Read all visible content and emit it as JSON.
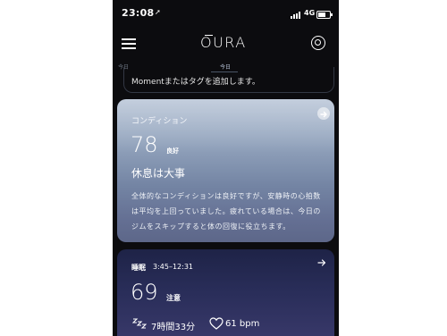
{
  "status_bar": {
    "time": "23:08",
    "location_icon": "location-arrow-icon",
    "network": "4G",
    "battery_level": 0.7
  },
  "header": {
    "menu_icon": "hamburger-menu-icon",
    "brand": "OURA",
    "settings_icon": "settings-ring-icon"
  },
  "day_tabs": {
    "prev": "今日",
    "current": "今日"
  },
  "moment_banner": {
    "text": "Momentまたはタグを追加します。"
  },
  "readiness_card": {
    "title": "コンディション",
    "score": "78",
    "rating": "良好",
    "headline": "休息は大事",
    "description": "全体的なコンディションは良好ですが、安静時の心拍数は平均を上回っていました。疲れている場合は、今日のジムをスキップすると体の回復に役立ちます。",
    "arrow_icon": "arrow-right-circle-icon"
  },
  "sleep_card": {
    "title": "睡眠",
    "time_range": "3:45–12:31",
    "score": "69",
    "rating": "注意",
    "duration": "7時間33分",
    "heart_rate": "61 bpm",
    "arrow_icon": "arrow-right-icon",
    "sleep_icon": "zzz-icon",
    "heart_icon": "heart-icon"
  },
  "colors": {
    "background": "#0c0c0f",
    "readiness_card_top": "#b0bed2",
    "readiness_card_bottom": "#5d6789",
    "sleep_card_top": "#1e2347",
    "sleep_card_bottom": "#3b3a6c"
  }
}
